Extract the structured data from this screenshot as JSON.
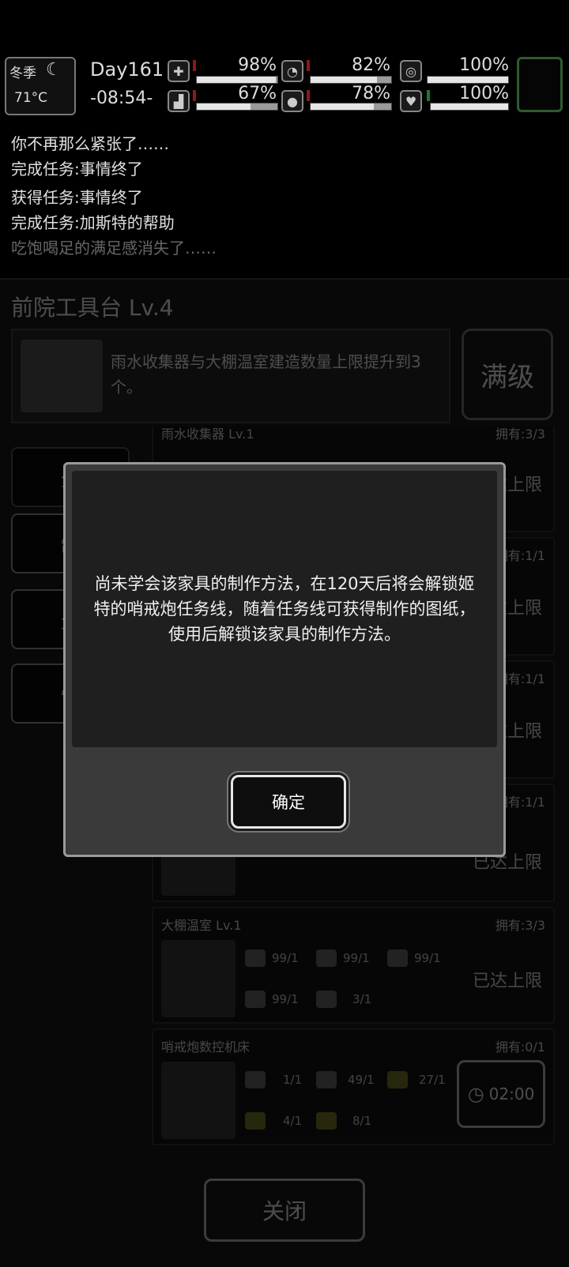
{
  "status": {
    "season": "冬季",
    "temperature": "71°C",
    "day": "Day161",
    "time": "-08:54-",
    "stats": [
      {
        "icon": "medkit-icon",
        "glyph": "✚",
        "value": "98%",
        "level": 0.98
      },
      {
        "icon": "stomach-icon",
        "glyph": "◔",
        "value": "82%",
        "level": 0.82
      },
      {
        "icon": "bag-icon",
        "glyph": "◎",
        "value": "100%",
        "level": 1.0
      },
      {
        "icon": "boot-icon",
        "glyph": "▟",
        "value": "67%",
        "level": 0.67
      },
      {
        "icon": "water-drop-icon",
        "glyph": "●",
        "value": "78%",
        "level": 0.78
      },
      {
        "icon": "heart-icon",
        "glyph": "♥",
        "value": "100%",
        "level": 1.0
      }
    ]
  },
  "log": [
    "你不再那么紧张了……",
    "完成任务:事情终了",
    "获得任务:事情终了",
    "完成任务:加斯特的帮助",
    "吃饱喝足的满足感消失了……"
  ],
  "panel": {
    "title": "前院工具台 Lv.4",
    "description": "雨水收集器与大棚温室建造数量上限提升到3个。",
    "level_badge": "满级",
    "categories": [
      "全",
      "制",
      "生",
      "恢"
    ],
    "close_label": "关闭"
  },
  "items": [
    {
      "name": "雨水收集器 Lv.1",
      "owned": "拥有:3/3",
      "status": "已达上限"
    },
    {
      "name": "",
      "owned": "拥有:1/1",
      "status": "已达上限"
    },
    {
      "name": "",
      "owned": "拥有:1/1",
      "status": "已达上限"
    },
    {
      "name": "",
      "owned": "拥有:1/1",
      "status": "已达上限"
    },
    {
      "name": "大棚温室 Lv.1",
      "owned": "拥有:3/3",
      "status": "已达上限",
      "resources": [
        "99/1",
        "99/1",
        "99/1",
        "99/1",
        "3/1"
      ]
    },
    {
      "name": "哨戒炮数控机床",
      "owned": "拥有:0/1",
      "timer": "02:00",
      "resources": [
        "1/1",
        "49/1",
        "27/1",
        "4/1",
        "8/1"
      ]
    }
  ],
  "dialog": {
    "message": "尚未学会该家具的制作方法，在120天后将会解锁姬特的哨戒炮任务线，随着任务线可获得制作的图纸，使用后解锁该家具的制作方法。",
    "confirm_label": "确定"
  }
}
